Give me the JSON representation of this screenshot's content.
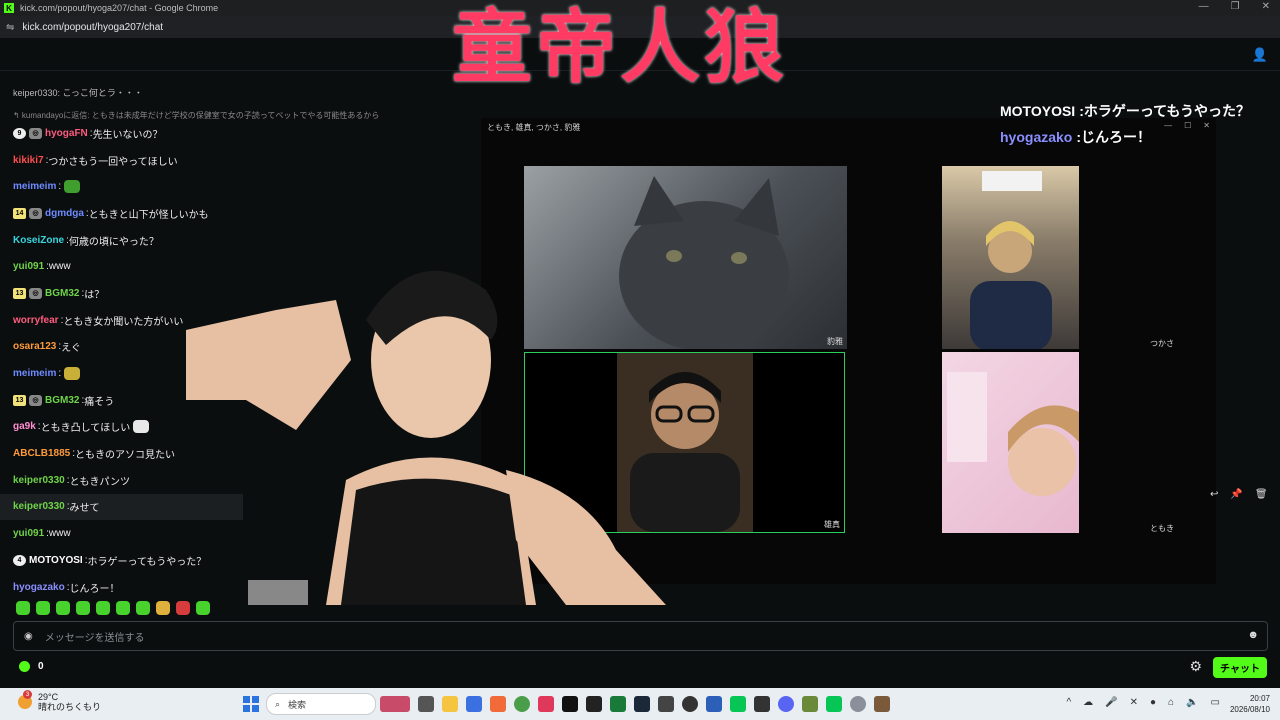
{
  "window": {
    "title": "kick.com/popout/hyoga207/chat - Google Chrome",
    "logo": "K",
    "url": "kick.com/popout/hyoga207/chat"
  },
  "banner": {
    "text": "童帝人狼"
  },
  "pinned": {
    "text": "keiper0330: こっこ何とラ・・・"
  },
  "reply_context": "↰ kumandayoに返信: ともきは未成年だけど学校の保健室で女の子読ってベットでやる可能性あるから",
  "messages": [
    {
      "badges": [
        "9",
        "gift"
      ],
      "user": "hyogaFN",
      "color": "#ff5b7f",
      "text": "先生いないの？"
    },
    {
      "badges": [],
      "user": "kikiki7",
      "color": "#ff4d4d",
      "text": "つかさもう一回やってほしい"
    },
    {
      "badges": [],
      "user": "meimeim",
      "color": "#6e8bff",
      "text": "",
      "emote": "#3f9e2e"
    },
    {
      "badges": [
        "14",
        "gift"
      ],
      "user": "dgmdga",
      "color": "#6e8bff",
      "text": "ともきと山下が怪しいかも"
    },
    {
      "badges": [],
      "user": "KoseiZone",
      "color": "#38d6e0",
      "text": "何歳の頃にやった？"
    },
    {
      "badges": [],
      "user": "yui091",
      "color": "#6fd44a",
      "text": "www"
    },
    {
      "badges": [
        "13",
        "gift"
      ],
      "user": "BGM32",
      "color": "#6fd44a",
      "text": "は？"
    },
    {
      "badges": [],
      "user": "worryfear",
      "color": "#ff5b7f",
      "text": "ともき女か聞いた方がいい"
    },
    {
      "badges": [],
      "user": "osara123",
      "color": "#ff9a3c",
      "text": "えぐ"
    },
    {
      "badges": [],
      "user": "meimeim",
      "color": "#6e8bff",
      "text": "",
      "emote": "#c8b038"
    },
    {
      "badges": [
        "13",
        "gift"
      ],
      "user": "BGM32",
      "color": "#6fd44a",
      "text": "痛そう"
    },
    {
      "badges": [],
      "user": "ga9k",
      "color": "#ff8fd0",
      "text": "ともき凸してほしい",
      "emote": "#e8e8e8"
    },
    {
      "badges": [],
      "user": "ABCLB1885",
      "color": "#ff9a3c",
      "text": "ともきのアソコ見たい"
    },
    {
      "badges": [],
      "user": "keiper0330",
      "color": "#6fd44a",
      "text": "ともきパンツ"
    },
    {
      "badges": [],
      "user": "keiper0330",
      "color": "#6fd44a",
      "text": "みせて",
      "highlight": true
    },
    {
      "badges": [],
      "user": "yui091",
      "color": "#6fd44a",
      "text": "www"
    },
    {
      "badges": [
        "4"
      ],
      "user": "MOTOYOSI",
      "color": "#ffffff",
      "text": "ホラゲーってもうやった？",
      "circle": true
    },
    {
      "badges": [],
      "user": "hyogazako",
      "color": "#8a8fff",
      "text": "じんろー！"
    }
  ],
  "overlay": [
    {
      "user": "MOTOYOSI",
      "color": "#ffffff",
      "text": "ホラゲーってもうやった？"
    },
    {
      "user": "hyogazako",
      "color": "#8a8fff",
      "text": "じんろー！"
    }
  ],
  "call_window": {
    "title": "ともき, 雄真, つかさ, 豹雅",
    "tiles": [
      {
        "label": "豹雅"
      },
      {
        "label": "つかさ"
      },
      {
        "label": "雄真",
        "speaking": true
      },
      {
        "label": "ともき"
      }
    ]
  },
  "input": {
    "placeholder": "メッセージを送信する"
  },
  "points": "0",
  "send_label": "チャット",
  "taskbar": {
    "weather_temp": "29°C",
    "weather_desc": "晴れのちくもり",
    "weather_badge": "3",
    "search": "検索",
    "time": "20:07",
    "date": "2026/08/10"
  }
}
